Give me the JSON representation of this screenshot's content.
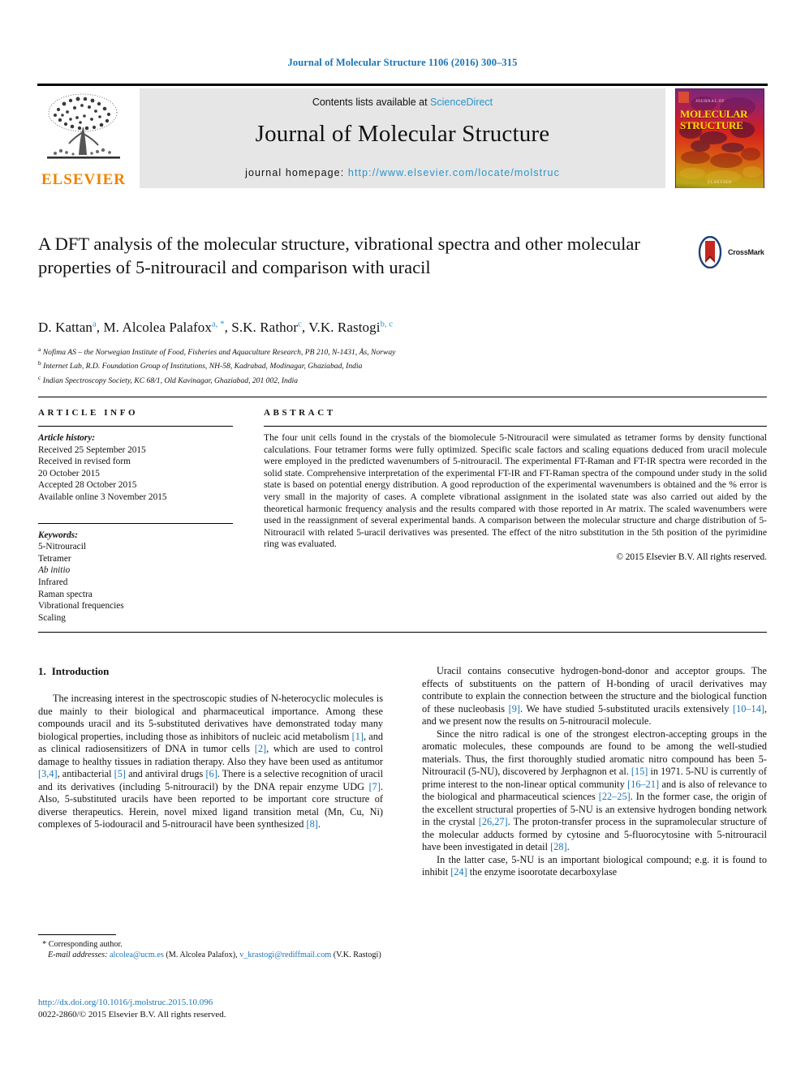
{
  "running_head": "Journal of Molecular Structure 1106 (2016) 300–315",
  "masthead": {
    "publisher_name": "ELSEVIER",
    "contents_prefix": "Contents lists available at ",
    "contents_link": "ScienceDirect",
    "journal_name": "Journal of Molecular Structure",
    "homepage_prefix": "journal homepage: ",
    "homepage_url": "http://www.elsevier.com/locate/molstruc",
    "cover": {
      "title_line1": "MOLECULAR",
      "title_line2": "STRUCTURE",
      "top_small": "JOURNAL OF",
      "bottom_small": "ELSEVIER"
    }
  },
  "article": {
    "title": "A DFT analysis of the molecular structure, vibrational spectra and other molecular properties of 5-nitrouracil and comparison with uracil",
    "crossmark_label": "CrossMark",
    "authors": [
      {
        "name": "D. Kattan",
        "sup": "a"
      },
      {
        "name": "M. Alcolea Palafox",
        "sup": "a, *"
      },
      {
        "name": "S.K. Rathor",
        "sup": "c"
      },
      {
        "name": "V.K. Rastogi",
        "sup": "b, c"
      }
    ],
    "affiliations": [
      {
        "mark": "a",
        "text": "Nofima AS – the Norwegian Institute of Food, Fisheries and Aquaculture Research, PB 210, N-1431, Ås, Norway"
      },
      {
        "mark": "b",
        "text": "Internet Lab, R.D. Foundation Group of Institutions, NH-58, Kadrabad, Modinagar, Ghaziabad, India"
      },
      {
        "mark": "c",
        "text": "Indian Spectroscopy Society, KC 68/1, Old Kavinagar, Ghaziabad, 201 002, India"
      }
    ]
  },
  "article_info": {
    "heading": "ARTICLE INFO",
    "history_label": "Article history:",
    "history": [
      "Received 25 September 2015",
      "Received in revised form",
      "20 October 2015",
      "Accepted 28 October 2015",
      "Available online 3 November 2015"
    ],
    "keywords_label": "Keywords:",
    "keywords": [
      {
        "text": "5-Nitrouracil",
        "italic": false
      },
      {
        "text": "Tetramer",
        "italic": false
      },
      {
        "text": "Ab initio",
        "italic": true
      },
      {
        "text": "Infrared",
        "italic": false
      },
      {
        "text": "Raman spectra",
        "italic": false
      },
      {
        "text": "Vibrational frequencies",
        "italic": false
      },
      {
        "text": "Scaling",
        "italic": false
      }
    ]
  },
  "abstract": {
    "heading": "ABSTRACT",
    "text": "The four unit cells found in the crystals of the biomolecule 5-Nitrouracil were simulated as tetramer forms by density functional calculations. Four tetramer forms were fully optimized. Specific scale factors and scaling equations deduced from uracil molecule were employed in the predicted wavenumbers of 5-nitrouracil. The experimental FT-Raman and FT-IR spectra were recorded in the solid state. Comprehensive interpretation of the experimental FT-IR and FT-Raman spectra of the compound under study in the solid state is based on potential energy distribution. A good reproduction of the experimental wavenumbers is obtained and the % error is very small in the majority of cases. A complete vibrational assignment in the isolated state was also carried out aided by the theoretical harmonic frequency analysis and the results compared with those reported in Ar matrix. The scaled wavenumbers were used in the reassignment of several experimental bands. A comparison between the molecular structure and charge distribution of 5-Nitrouracil with related 5-uracil derivatives was presented. The effect of the nitro substitution in the 5th position of the pyrimidine ring was evaluated.",
    "copyright": "© 2015 Elsevier B.V. All rights reserved."
  },
  "introduction": {
    "number": "1.",
    "heading": "Introduction",
    "left_paragraphs": [
      "The increasing interest in the spectroscopic studies of N-heterocyclic molecules is due mainly to their biological and pharmaceutical importance. Among these compounds uracil and its 5-substituted derivatives have demonstrated today many biological properties, including those as inhibitors of nucleic acid metabolism [1], and as clinical radiosensitizers of DNA in tumor cells [2], which are used to control damage to healthy tissues in radiation therapy. Also they have been used as antitumor [3,4], antibacterial [5] and antiviral drugs [6]. There is a selective recognition of uracil and its derivatives (including 5-nitrouracil) by the DNA repair enzyme UDG [7]. Also, 5-substituted uracils have been reported to be important core structure of diverse therapeutics. Herein, novel mixed ligand transition metal (Mn, Cu, Ni) complexes of 5-iodouracil and 5-nitrouracil have been synthesized [8]."
    ],
    "right_paragraphs": [
      "Uracil contains consecutive hydrogen-bond-donor and acceptor groups. The effects of substituents on the pattern of H-bonding of uracil derivatives may contribute to explain the connection between the structure and the biological function of these nucleobasis [9]. We have studied 5-substituted uracils extensively [10–14], and we present now the results on 5-nitrouracil molecule.",
      "Since the nitro radical is one of the strongest electron-accepting groups in the aromatic molecules, these compounds are found to be among the well-studied materials. Thus, the first thoroughly studied aromatic nitro compound has been 5-Nitrouracil (5-NU), discovered by Jerphagnon et al. [15] in 1971. 5-NU is currently of prime interest to the non-linear optical community [16–21] and is also of relevance to the biological and pharmaceutical sciences [22–25]. In the former case, the origin of the excellent structural properties of 5-NU is an extensive hydrogen bonding network in the crystal [26,27]. The proton-transfer process in the supramolecular structure of the molecular adducts formed by cytosine and 5-fluorocytosine with 5-nitrouracil have been investigated in detail [28].",
      "In the latter case, 5-NU is an important biological compound; e.g. it is found to inhibit [24] the enzyme isoorotate decarboxylase"
    ],
    "citation_tokens": [
      "[1]",
      "[2]",
      "[3,4]",
      "[5]",
      "[6]",
      "[7]",
      "[8]",
      "[9]",
      "[10–14]",
      "[15]",
      "[16–21]",
      "[22–25]",
      "[26,27]",
      "[28]",
      "[24]"
    ]
  },
  "footer": {
    "corresponding_marker": "*",
    "corresponding_text": "Corresponding author.",
    "email_label": "E-mail addresses:",
    "emails": [
      {
        "address": "alcolea@ucm.es",
        "owner": "(M. Alcolea Palafox)"
      },
      {
        "address": "v_krastogi@rediffmail.com",
        "owner": "(V.K. Rastogi)"
      }
    ],
    "doi": "http://dx.doi.org/10.1016/j.molstruc.2015.10.096",
    "issn_line": "0022-2860/© 2015 Elsevier B.V. All rights reserved."
  },
  "colors": {
    "link_blue": "#1a75b8",
    "sciencedirect_blue": "#2a94c9",
    "elsevier_orange": "#ef8200",
    "masthead_gray": "#e6e6e6",
    "cover_yellow": "#ffdf00"
  }
}
